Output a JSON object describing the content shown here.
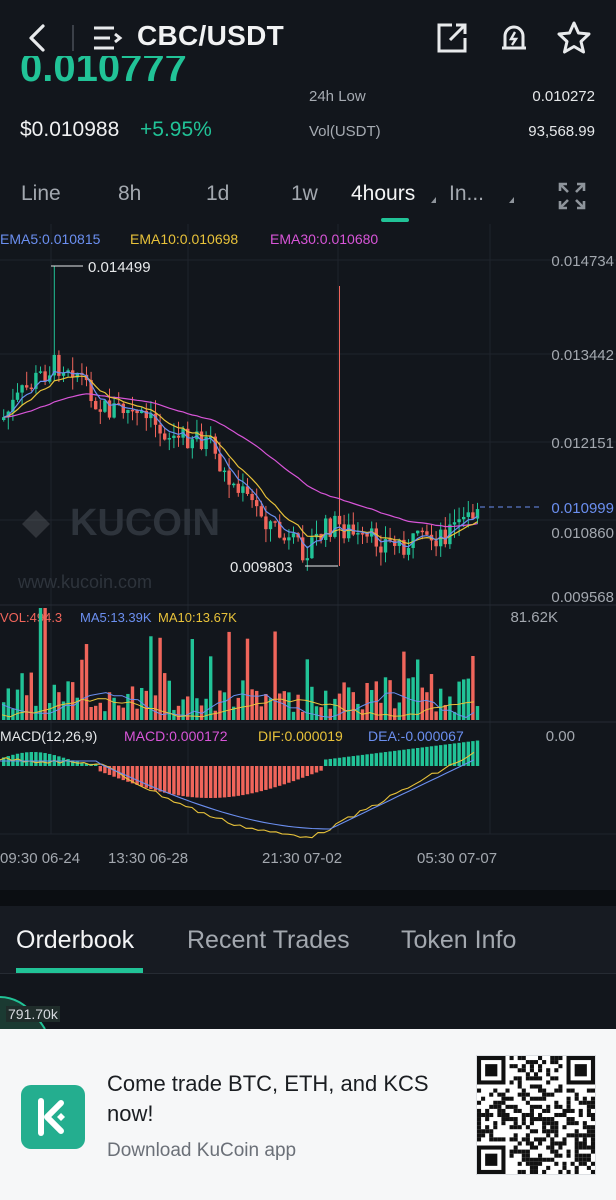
{
  "header": {
    "pair": "CBC/USDT",
    "icons": [
      "back-icon",
      "menu-icon",
      "share-icon",
      "price-alert-icon",
      "favorite-star-icon"
    ]
  },
  "price": {
    "last_partial": "0.010777",
    "usd": "$0.010988",
    "change": "+5.95%",
    "low_label": "24h Low",
    "low_value": "0.010272",
    "vol_label": "Vol(USDT)",
    "vol_value": "93,568.99"
  },
  "intervals": {
    "tabs": [
      "Line",
      "8h",
      "1d",
      "1w",
      "4hours",
      "In..."
    ],
    "active": "4hours"
  },
  "indicators": {
    "ema": [
      "EMA5:0.010815",
      "EMA10:0.010698",
      "EMA30:0.010680"
    ],
    "vol": [
      "VOL:494.3",
      "MA5:13.39K",
      "MA10:13.67K"
    ],
    "vol_max": "81.62K",
    "macd": [
      "MACD(12,26,9)",
      "MACD:0.000172",
      "DIF:0.000019",
      "DEA:-0.000067"
    ],
    "macd_zero": "0.00"
  },
  "chart_data": {
    "type": "candlestick",
    "price_axis_ticks": [
      "0.014734",
      "0.013442",
      "0.012151",
      "0.010860",
      "0.009568"
    ],
    "current_price_marker": "0.010999",
    "high_annotation": "0.014499",
    "low_annotation": "0.009803",
    "x_tick_labels": [
      "09:30 06-24",
      "13:30 06-28",
      "21:30 07-02",
      "05:30 07-07"
    ],
    "ylim": [
      0.009568,
      0.014734
    ],
    "watermark": "KUCOIN",
    "watermark_url": "www.kucoin.com",
    "colors": {
      "up": "#21c397",
      "down": "#f0655b",
      "ema5": "#6b8ff0",
      "ema10": "#e8c23a",
      "ema30": "#d855d8"
    }
  },
  "bottom_tabs": {
    "items": [
      "Orderbook",
      "Recent Trades",
      "Token Info"
    ],
    "active": "Orderbook"
  },
  "orderbook": {
    "depth_value": "791.70k"
  },
  "promo": {
    "text": "Come trade BTC, ETH, and KCS now!",
    "sub": "Download KuCoin app",
    "logo_color": "#24ae8f"
  }
}
